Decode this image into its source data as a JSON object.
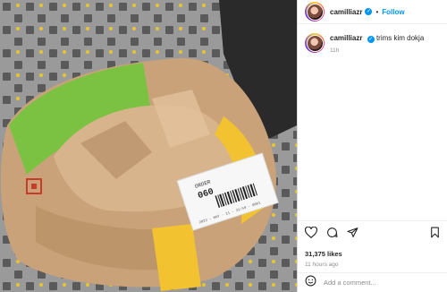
{
  "header": {
    "username": "camilliazr",
    "verified_icon": "verified-badge-icon",
    "separator": "•",
    "follow_label": "Follow"
  },
  "caption": {
    "username": "camilliazr",
    "text": "trims kim dokja",
    "time": "11h"
  },
  "receipt": {
    "order_label": "ORDER",
    "order_number": "060",
    "footer": "2022 - MAY - 11 - 21:59 - 0001"
  },
  "actions": {
    "like_icon": "heart-icon",
    "comment_icon": "comment-bubble-icon",
    "share_icon": "paper-plane-icon",
    "save_icon": "bookmark-icon"
  },
  "likes": "31,375 likes",
  "posted": "11 hours ago",
  "comment_box": {
    "emoji_icon": "smiley-icon",
    "placeholder": "Add a comment..."
  },
  "colors": {
    "brand_blue": "#0095f6",
    "bag_kraft": "#c9a27a",
    "bag_green": "#7cc242",
    "bag_yellow": "#f2c230"
  }
}
